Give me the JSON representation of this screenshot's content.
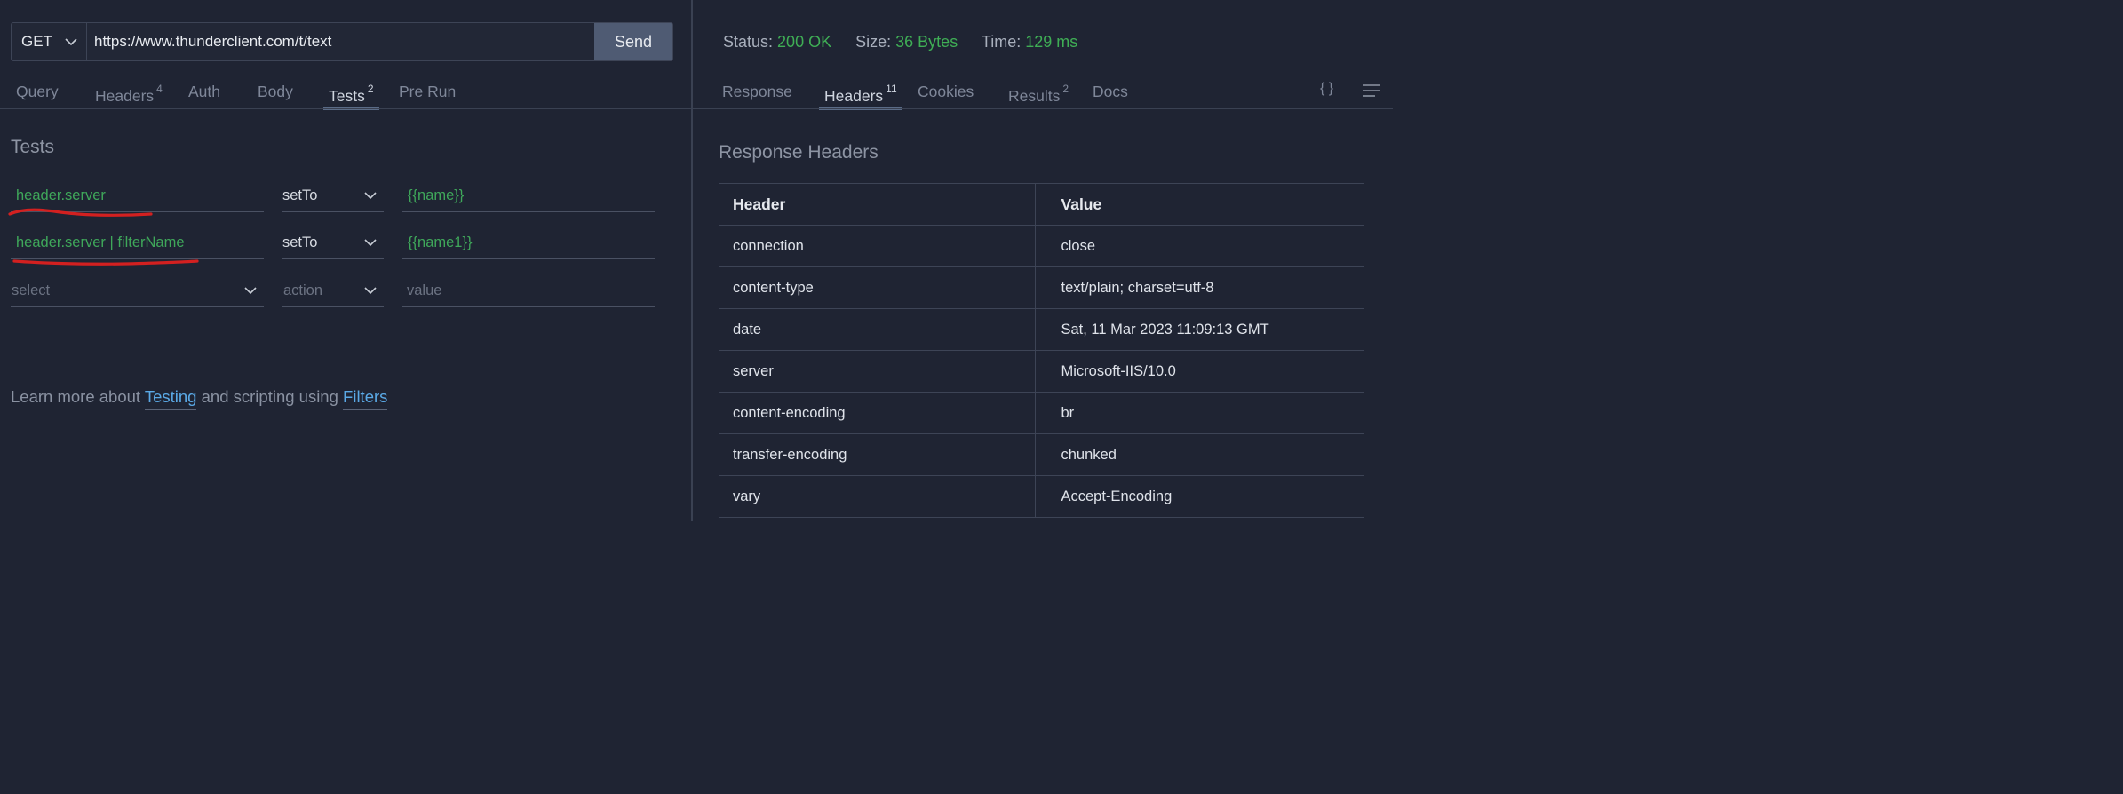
{
  "request": {
    "method": "GET",
    "url": "https://www.thunderclient.com/t/text",
    "send_label": "Send"
  },
  "request_tabs": [
    {
      "label": "Query",
      "count": ""
    },
    {
      "label": "Headers",
      "count": "4"
    },
    {
      "label": "Auth",
      "count": ""
    },
    {
      "label": "Body",
      "count": ""
    },
    {
      "label": "Tests",
      "count": "2",
      "active": true
    },
    {
      "label": "Pre Run",
      "count": ""
    }
  ],
  "tests": {
    "title": "Tests",
    "rows": [
      {
        "source": "header.server",
        "action": "setTo",
        "value": "{{name}}"
      },
      {
        "source": "header.server | filterName",
        "action": "setTo",
        "value": "{{name1}}"
      }
    ],
    "new_row": {
      "source_placeholder": "select",
      "action_placeholder": "action",
      "value_placeholder": "value"
    },
    "learn_more": {
      "prefix": "Learn more about ",
      "link1": "Testing",
      "middle": " and scripting using ",
      "link2": "Filters"
    },
    "highlight_color": "#d32020"
  },
  "response": {
    "status_label": "Status:",
    "status_value": "200 OK",
    "size_label": "Size:",
    "size_value": "36 Bytes",
    "time_label": "Time:",
    "time_value": "129 ms",
    "success_color": "#3fae55"
  },
  "response_tabs": [
    {
      "label": "Response",
      "count": ""
    },
    {
      "label": "Headers",
      "count": "11",
      "active": true
    },
    {
      "label": "Cookies",
      "count": ""
    },
    {
      "label": "Results",
      "count": "2"
    },
    {
      "label": "Docs",
      "count": ""
    }
  ],
  "response_tools": {
    "braces_icon": "{ }",
    "menu_icon": "menu-icon"
  },
  "response_headers": {
    "title": "Response Headers",
    "col_header": "Header",
    "col_value": "Value",
    "rows": [
      {
        "name": "connection",
        "value": "close"
      },
      {
        "name": "content-type",
        "value": "text/plain; charset=utf-8"
      },
      {
        "name": "date",
        "value": "Sat, 11 Mar 2023 11:09:13 GMT"
      },
      {
        "name": "server",
        "value": "Microsoft-IIS/10.0"
      },
      {
        "name": "content-encoding",
        "value": "br"
      },
      {
        "name": "transfer-encoding",
        "value": "chunked"
      },
      {
        "name": "vary",
        "value": "Accept-Encoding"
      }
    ]
  }
}
